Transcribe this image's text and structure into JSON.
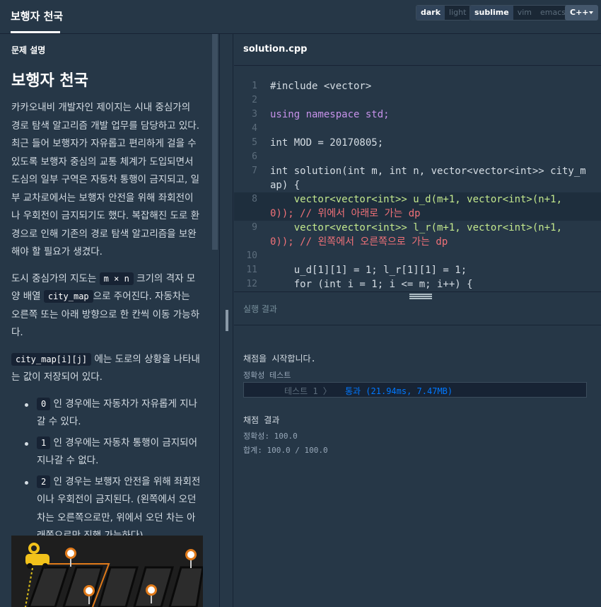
{
  "header": {
    "tab_title": "보행자 천국",
    "theme_options": [
      "dark",
      "light"
    ],
    "keymap_options": [
      "sublime",
      "vim",
      "emacs"
    ],
    "language": "C++"
  },
  "problem": {
    "section_label": "문제 설명",
    "title": "보행자 천국",
    "para1": "카카오내비 개발자인 제이지는 시내 중심가의 경로 탐색 알고리즘 개발 업무를 담당하고 있다. 최근 들어 보행자가 자유롭고 편리하게 걸을 수 있도록 보행자 중심의 교통 체계가 도입되면서 도심의 일부 구역은 자동차 통행이 금지되고, 일부 교차로에서는 보행자 안전을 위해 좌회전이나 우회전이 금지되기도 했다. 복잡해진 도로 환경으로 인해 기존의 경로 탐색 알고리즘을 보완해야 할 필요가 생겼다.",
    "para2_a": "도시 중심가의 지도는",
    "para2_code1": "m × n",
    "para2_b": "크기의 격자 모양 배열",
    "para2_code2": "city_map",
    "para2_c": "으로 주어진다. 자동차는 오른쪽 또는 아래 방향으로 한 칸씩 이동 가능하다.",
    "para3_code": "city_map[i][j]",
    "para3_text": "에는 도로의 상황을 나타내는 값이 저장되어 있다.",
    "rules": [
      {
        "code": "0",
        "text": "인 경우에는 자동차가 자유롭게 지나갈 수 있다."
      },
      {
        "code": "1",
        "text": "인 경우에는 자동차 통행이 금지되어 지나갈 수 없다."
      },
      {
        "code": "2",
        "text": "인 경우는 보행자 안전을 위해 좌회전이나 우회전이 금지된다. (왼쪽에서 오던 차는 오른쪽으로만, 위에서 오던 차는 아래쪽으로만 진행 가능하다)"
      }
    ]
  },
  "editor": {
    "filename": "solution.cpp",
    "line_numbers": [
      "1",
      "2",
      "3",
      "4",
      "5",
      "6",
      "7",
      "",
      "8",
      "",
      "9",
      "",
      "10",
      "11",
      "12"
    ],
    "lines": [
      "#include <vector>",
      "",
      "using namespace std;",
      "",
      "int MOD = 20170805;",
      "",
      "int solution(int m, int n, vector<vector<int>> city_m",
      "ap) {",
      "    vector<vector<int>> u_d(m+1, vector<int>(n+1,",
      "0)); // 위에서 아래로 가는 dp",
      "    vector<vector<int>> l_r(m+1, vector<int>(n+1,",
      "0)); // 왼쪽에서 오른쪽으로 가는 dp",
      "",
      "    u_d[1][1] = 1; l_r[1][1] = 1;",
      "    for (int i = 1; i <= m; i++) {"
    ]
  },
  "results": {
    "header": "실행 결과",
    "start_msg": "채점을 시작합니다.",
    "accuracy_test_label": "정확성  테스트",
    "test_case": "테스트 1 〉",
    "test_result": "통과 (21.94ms, 7.47MB)",
    "result_label": "채점 결과",
    "accuracy_score": "정확성: 100.0",
    "total_score": "합계: 100.0 / 100.0"
  }
}
